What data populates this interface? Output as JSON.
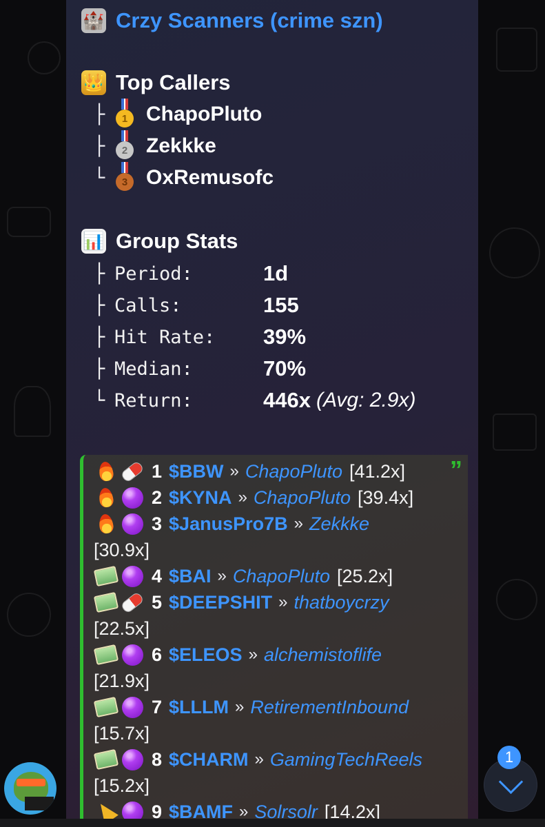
{
  "message": {
    "title_emoji": "🏰",
    "title": "Crzy Scanners (crime szn)",
    "top_callers": {
      "header_emoji": "👑",
      "header": "Top Callers",
      "items": [
        {
          "branch": "├",
          "medal": "1",
          "name": "ChapoPluto"
        },
        {
          "branch": "├",
          "medal": "2",
          "name": "Zekkke"
        },
        {
          "branch": "└",
          "medal": "3",
          "name": "OxRemusofc"
        }
      ]
    },
    "group_stats": {
      "header_emoji": "📊",
      "header": "Group Stats",
      "rows": [
        {
          "branch": "├",
          "label": "Period:",
          "value": "1d",
          "extra": ""
        },
        {
          "branch": "├",
          "label": "Calls:",
          "value": "155",
          "extra": ""
        },
        {
          "branch": "├",
          "label": "Hit Rate:",
          "value": "39%",
          "extra": ""
        },
        {
          "branch": "├",
          "label": "Median:",
          "value": "70%",
          "extra": ""
        },
        {
          "branch": "└",
          "label": "Return:",
          "value": "446x",
          "extra": "(Avg: 2.9x)"
        }
      ]
    },
    "quote_mark": "”",
    "calls": [
      {
        "icon1": "fire",
        "icon2": "pill",
        "rank": "1",
        "ticker": "$BBW",
        "sep": "»",
        "caller": "ChapoPluto",
        "mult": "[41.2x]"
      },
      {
        "icon1": "fire",
        "icon2": "purple-circle",
        "rank": "2",
        "ticker": "$KYNA",
        "sep": "»",
        "caller": "ChapoPluto",
        "mult": "[39.4x]"
      },
      {
        "icon1": "fire",
        "icon2": "purple-circle",
        "rank": "3",
        "ticker": "$JanusPro7B",
        "sep": "»",
        "caller": "Zekkke",
        "mult": "[30.9x]"
      },
      {
        "icon1": "money-wings",
        "icon2": "purple-circle",
        "rank": "4",
        "ticker": "$BAI",
        "sep": "»",
        "caller": "ChapoPluto",
        "mult": "[25.2x]"
      },
      {
        "icon1": "money-wings",
        "icon2": "pill",
        "rank": "5",
        "ticker": "$DEEPSHIT",
        "sep": "»",
        "caller": "thatboycrzy",
        "mult": "[22.5x]"
      },
      {
        "icon1": "money-wings",
        "icon2": "purple-circle",
        "rank": "6",
        "ticker": "$ELEOS",
        "sep": "»",
        "caller": "alchemistoflife",
        "mult": "[21.9x]"
      },
      {
        "icon1": "money-wings",
        "icon2": "purple-circle",
        "rank": "7",
        "ticker": "$LLLM",
        "sep": "»",
        "caller": "RetirementInbound",
        "mult": "[15.7x]"
      },
      {
        "icon1": "money-wings",
        "icon2": "purple-circle",
        "rank": "8",
        "ticker": "$CHARM",
        "sep": "»",
        "caller": "GamingTechReels",
        "mult": "[15.2x]"
      },
      {
        "icon1": "party-popper",
        "icon2": "purple-circle",
        "rank": "9",
        "ticker": "$BAMF",
        "sep": "»",
        "caller": "Solrsolr",
        "mult": "[14.2x]"
      }
    ]
  },
  "scroll_down": {
    "unread_count": "1"
  },
  "colors": {
    "link": "#3e95ff",
    "quote_bar": "#2fbf2f",
    "bubble": "#24243a"
  }
}
